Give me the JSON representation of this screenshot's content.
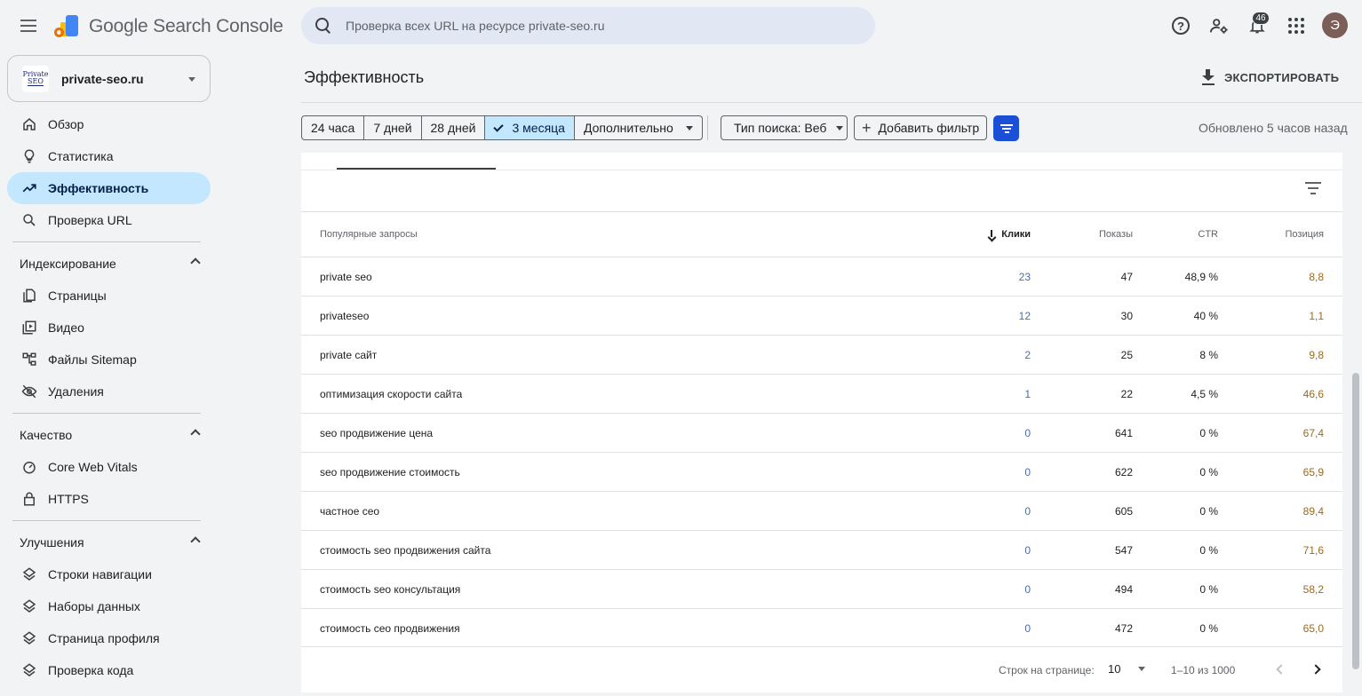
{
  "app": {
    "title": "Google Search Console"
  },
  "search": {
    "placeholder": "Проверка всех URL на ресурсе private-seo.ru"
  },
  "notifications": {
    "count": "46"
  },
  "avatar": {
    "initial": "Э"
  },
  "property": {
    "logo_line1": "Private",
    "logo_line2": "SEO",
    "name": "private-seo.ru"
  },
  "sidebar": {
    "top_items": [
      {
        "label": "Обзор",
        "icon": "home-icon"
      },
      {
        "label": "Статистика",
        "icon": "lightbulb-icon"
      },
      {
        "label": "Эффективность",
        "icon": "trending-up-icon",
        "active": true
      },
      {
        "label": "Проверка URL",
        "icon": "search-icon"
      }
    ],
    "indexing": {
      "title": "Индексирование",
      "items": [
        {
          "label": "Страницы",
          "icon": "pages-icon"
        },
        {
          "label": "Видео",
          "icon": "video-icon"
        },
        {
          "label": "Файлы Sitemap",
          "icon": "sitemap-icon"
        },
        {
          "label": "Удаления",
          "icon": "eye-off-icon"
        }
      ]
    },
    "quality": {
      "title": "Качество",
      "items": [
        {
          "label": "Core Web Vitals",
          "icon": "gauge-icon"
        },
        {
          "label": "HTTPS",
          "icon": "lock-icon"
        }
      ]
    },
    "enhancements": {
      "title": "Улучшения",
      "items": [
        {
          "label": "Строки навигации",
          "icon": "layers-icon"
        },
        {
          "label": "Наборы данных",
          "icon": "layers-icon"
        },
        {
          "label": "Страница профиля",
          "icon": "layers-icon"
        },
        {
          "label": "Проверка кода",
          "icon": "layers-icon"
        }
      ]
    }
  },
  "header": {
    "title": "Эффективность",
    "export_label": "ЭКСПОРТИРОВАТЬ"
  },
  "filters": {
    "ranges": [
      "24 часа",
      "7 дней",
      "28 дней",
      "3 месяца",
      "Дополнительно"
    ],
    "selected_range": "3 месяца",
    "search_type": "Тип поиска: Веб",
    "add_filter": "Добавить фильтр",
    "updated": "Обновлено 5 часов назад"
  },
  "table": {
    "columns": {
      "query": "Популярные запросы",
      "clicks": "Клики",
      "impressions": "Показы",
      "ctr": "CTR",
      "position": "Позиция"
    },
    "rows": [
      {
        "query": "private seo",
        "clicks": "23",
        "impressions": "47",
        "ctr": "48,9 %",
        "position": "8,8"
      },
      {
        "query": "privateseo",
        "clicks": "12",
        "impressions": "30",
        "ctr": "40 %",
        "position": "1,1"
      },
      {
        "query": "private сайт",
        "clicks": "2",
        "impressions": "25",
        "ctr": "8 %",
        "position": "9,8"
      },
      {
        "query": "оптимизация скорости сайта",
        "clicks": "1",
        "impressions": "22",
        "ctr": "4,5 %",
        "position": "46,6"
      },
      {
        "query": "seo продвижение цена",
        "clicks": "0",
        "impressions": "641",
        "ctr": "0 %",
        "position": "67,4"
      },
      {
        "query": "seo продвижение стоимость",
        "clicks": "0",
        "impressions": "622",
        "ctr": "0 %",
        "position": "65,9"
      },
      {
        "query": "частное сео",
        "clicks": "0",
        "impressions": "605",
        "ctr": "0 %",
        "position": "89,4"
      },
      {
        "query": "стоимость seo продвижения сайта",
        "clicks": "0",
        "impressions": "547",
        "ctr": "0 %",
        "position": "71,6"
      },
      {
        "query": "стоимость seo консультация",
        "clicks": "0",
        "impressions": "494",
        "ctr": "0 %",
        "position": "58,2"
      },
      {
        "query": "стоимость сео продвижения",
        "clicks": "0",
        "impressions": "472",
        "ctr": "0 %",
        "position": "65,0"
      }
    ]
  },
  "pagination": {
    "rows_label": "Строк на странице:",
    "rows_value": "10",
    "range": "1–10 из 1000"
  }
}
